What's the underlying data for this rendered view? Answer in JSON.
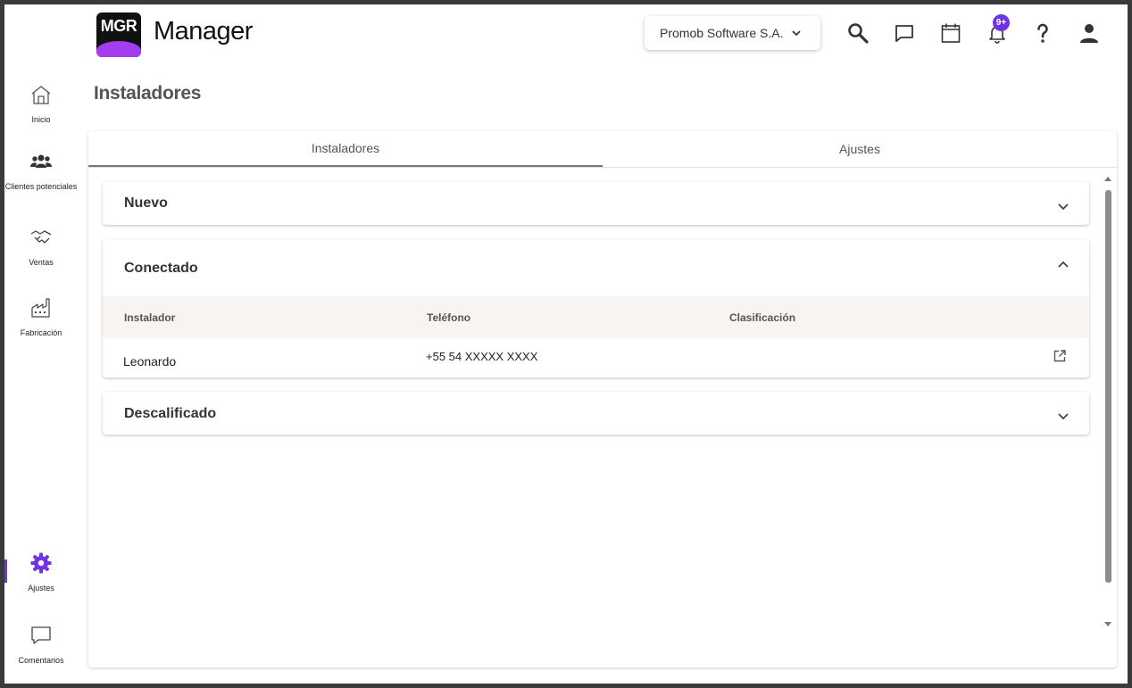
{
  "header": {
    "logo_text": "MGR",
    "app_name": "Manager",
    "company": "Promob Software S.A.",
    "notification_badge": "9+"
  },
  "sidebar": {
    "items": [
      {
        "label": "Inicio",
        "icon": "home-icon"
      },
      {
        "label": "Clientes potenciales",
        "icon": "people-icon"
      },
      {
        "label": "Ventas",
        "icon": "handshake-icon"
      },
      {
        "label": "Fabricación",
        "icon": "factory-icon"
      },
      {
        "label": "Ajustes",
        "icon": "gear-icon",
        "active": true
      },
      {
        "label": "Comentarios",
        "icon": "comment-icon"
      }
    ],
    "accent_color": "#6f32e6"
  },
  "page": {
    "title": "Instaladores",
    "tabs": [
      {
        "label": "Instaladores",
        "active": true
      },
      {
        "label": "Ajustes",
        "active": false
      }
    ]
  },
  "panels": {
    "nuevo": {
      "title": "Nuevo",
      "expanded": false
    },
    "conectado": {
      "title": "Conectado",
      "expanded": true,
      "columns": [
        "Instalador",
        "Teléfono",
        "Clasificación"
      ],
      "rows": [
        {
          "instalador": "Leonardo",
          "telefono": "+55 54 XXXXX XXXX",
          "clasificacion": ""
        }
      ]
    },
    "descalificado": {
      "title": "Descalificado",
      "expanded": false
    }
  }
}
